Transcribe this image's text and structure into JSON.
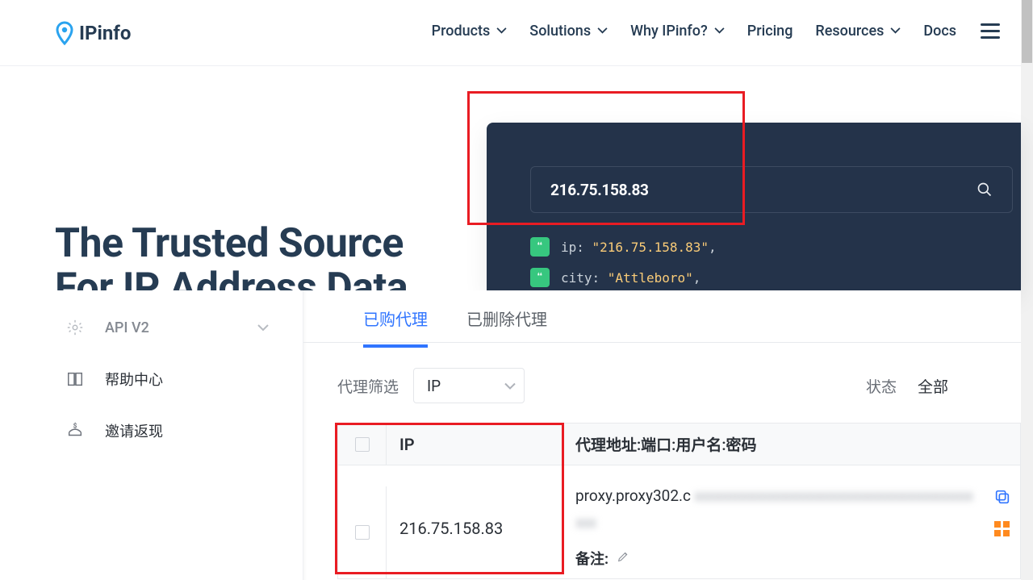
{
  "brand": {
    "name": "IPinfo"
  },
  "nav": {
    "products": "Products",
    "solutions": "Solutions",
    "why": "Why IPinfo?",
    "pricing": "Pricing",
    "resources": "Resources",
    "docs": "Docs"
  },
  "hero": {
    "line1": "The Trusted Source",
    "line2": "For IP Address Data"
  },
  "search": {
    "value": "216.75.158.83"
  },
  "json_preview": {
    "rows": [
      {
        "key": "ip",
        "value": "\"216.75.158.83\""
      },
      {
        "key": "city",
        "value": "\"Attleboro\""
      }
    ]
  },
  "sidebar": {
    "api": "API V2",
    "help": "帮助中心",
    "invite": "邀请返现"
  },
  "tabs": {
    "purchased": "已购代理",
    "deleted": "已删除代理"
  },
  "filter": {
    "label": "代理筛选",
    "dropdown": "IP"
  },
  "status": {
    "label": "状态",
    "dropdown": "全部"
  },
  "table": {
    "header_ip": "IP",
    "header_addr": "代理地址:端口:用户名:密码",
    "row": {
      "ip": "216.75.158.83",
      "addr_visible": "proxy.proxy302.c",
      "remark_label": "备注:"
    }
  }
}
